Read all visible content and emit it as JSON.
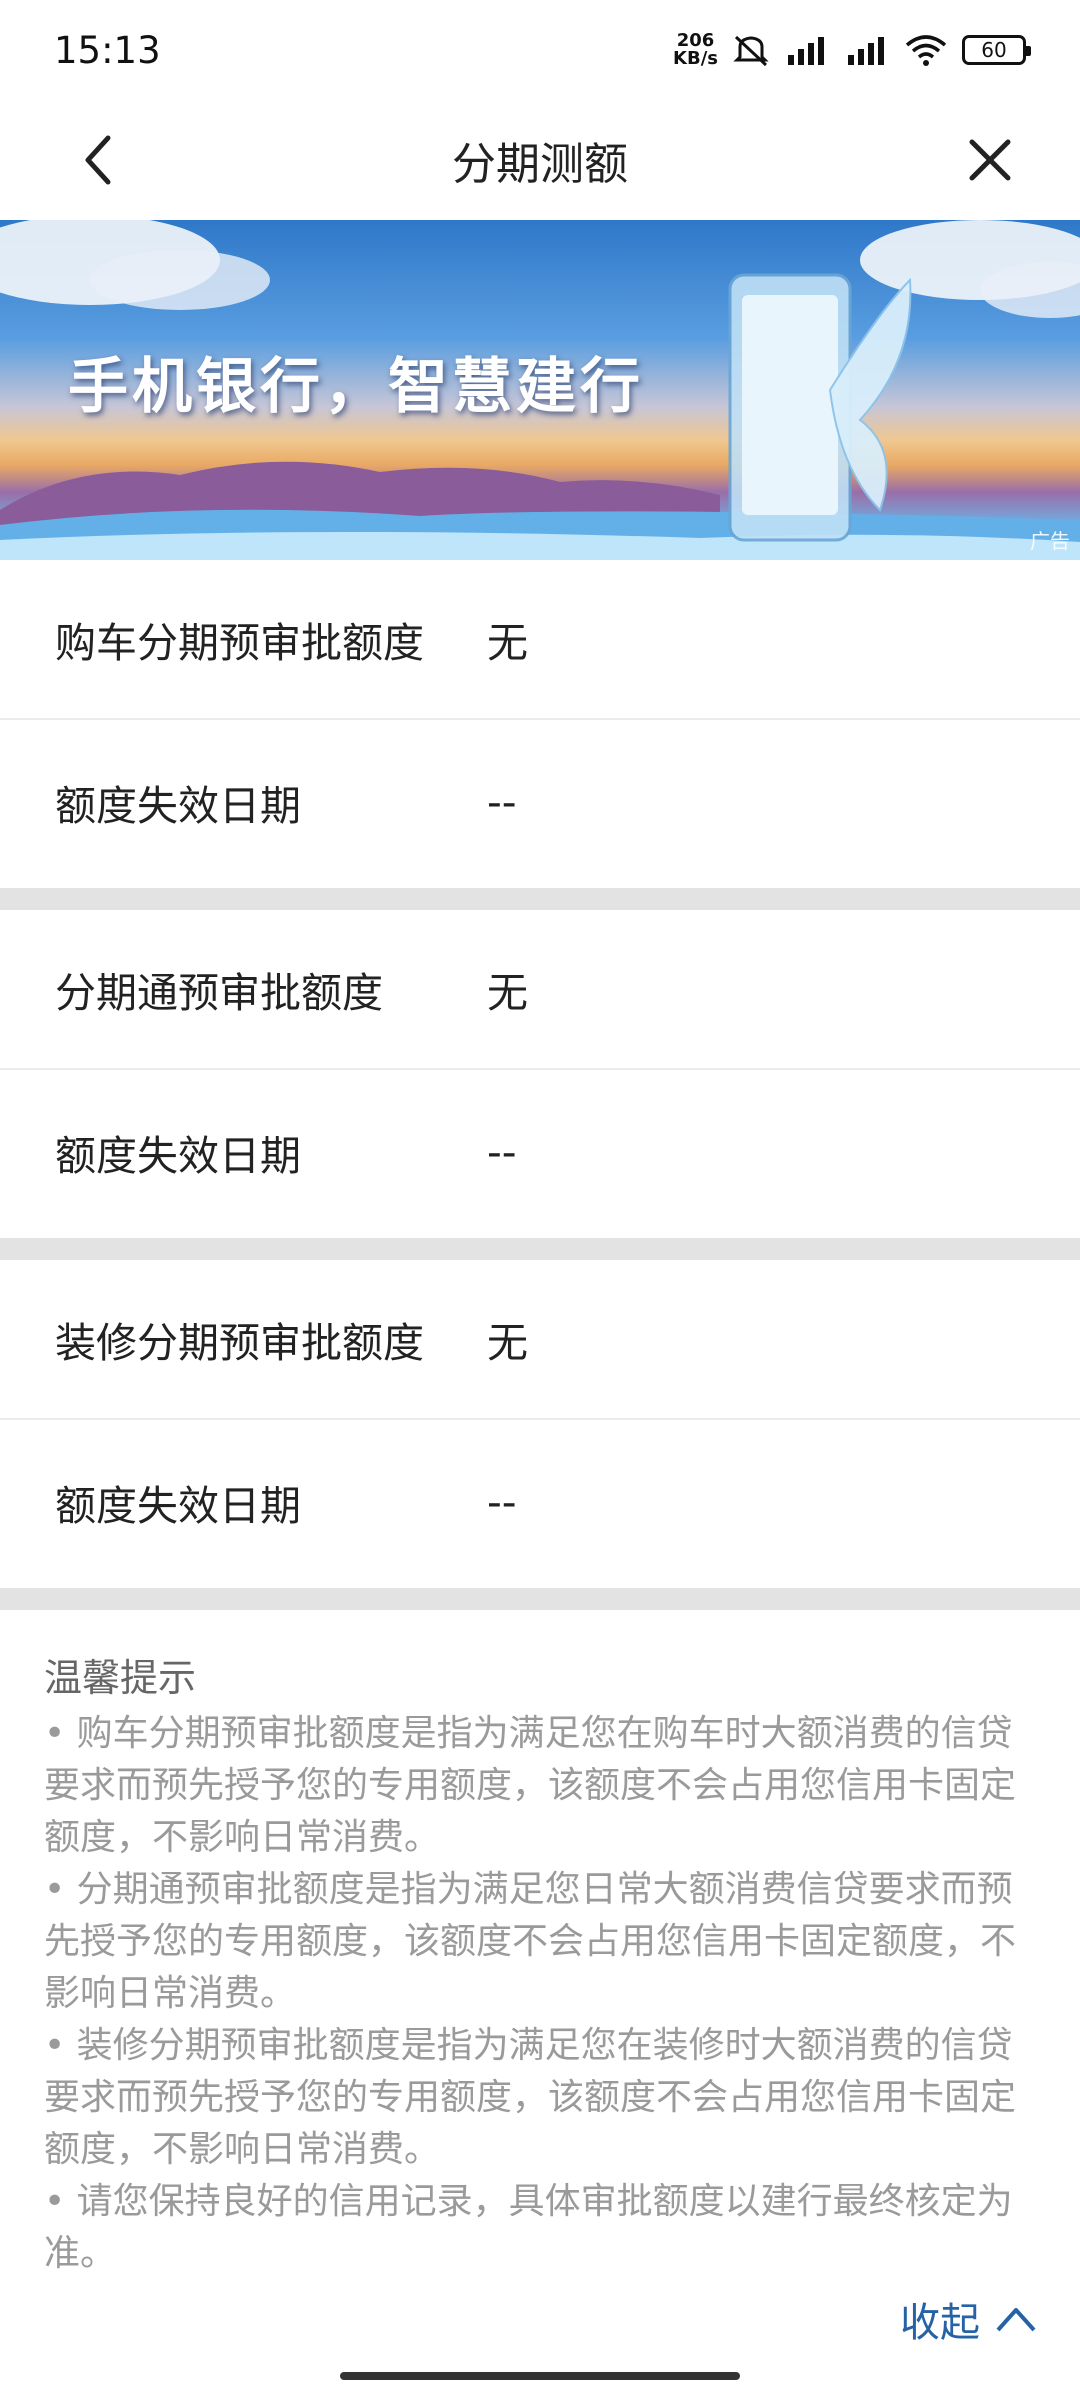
{
  "status_bar": {
    "time": "15:13",
    "net_speed_value": "206",
    "net_speed_unit": "KB/s",
    "battery": "60"
  },
  "header": {
    "title": "分期测额"
  },
  "banner": {
    "slogan": "手机银行，智慧建行",
    "ad_label": "广告"
  },
  "quota_groups": [
    {
      "quota_label": "购车分期预审批额度",
      "quota_value": "无",
      "expiry_label": "额度失效日期",
      "expiry_value": "--"
    },
    {
      "quota_label": "分期通预审批额度",
      "quota_value": "无",
      "expiry_label": "额度失效日期",
      "expiry_value": "--"
    },
    {
      "quota_label": "装修分期预审批额度",
      "quota_value": "无",
      "expiry_label": "额度失效日期",
      "expiry_value": "--"
    }
  ],
  "tips": {
    "title": "温馨提示",
    "items": [
      "•  购车分期预审批额度是指为满足您在购车时大额消费的信贷要求而预先授予您的专用额度，该额度不会占用您信用卡固定额度，不影响日常消费。",
      "•  分期通预审批额度是指为满足您日常大额消费信贷要求而预先授予您的专用额度，该额度不会占用您信用卡固定额度，不影响日常消费。",
      "•  装修分期预审批额度是指为满足您在装修时大额消费的信贷要求而预先授予您的专用额度，该额度不会占用您信用卡固定额度，不影响日常消费。",
      "•  请您保持良好的信用记录，具体审批额度以建行最终核定为准。"
    ],
    "collapse_label": "收起"
  },
  "colors": {
    "accent": "#2563a6",
    "divider": "#e3e3e3",
    "tip_text": "#9a9a9a"
  }
}
